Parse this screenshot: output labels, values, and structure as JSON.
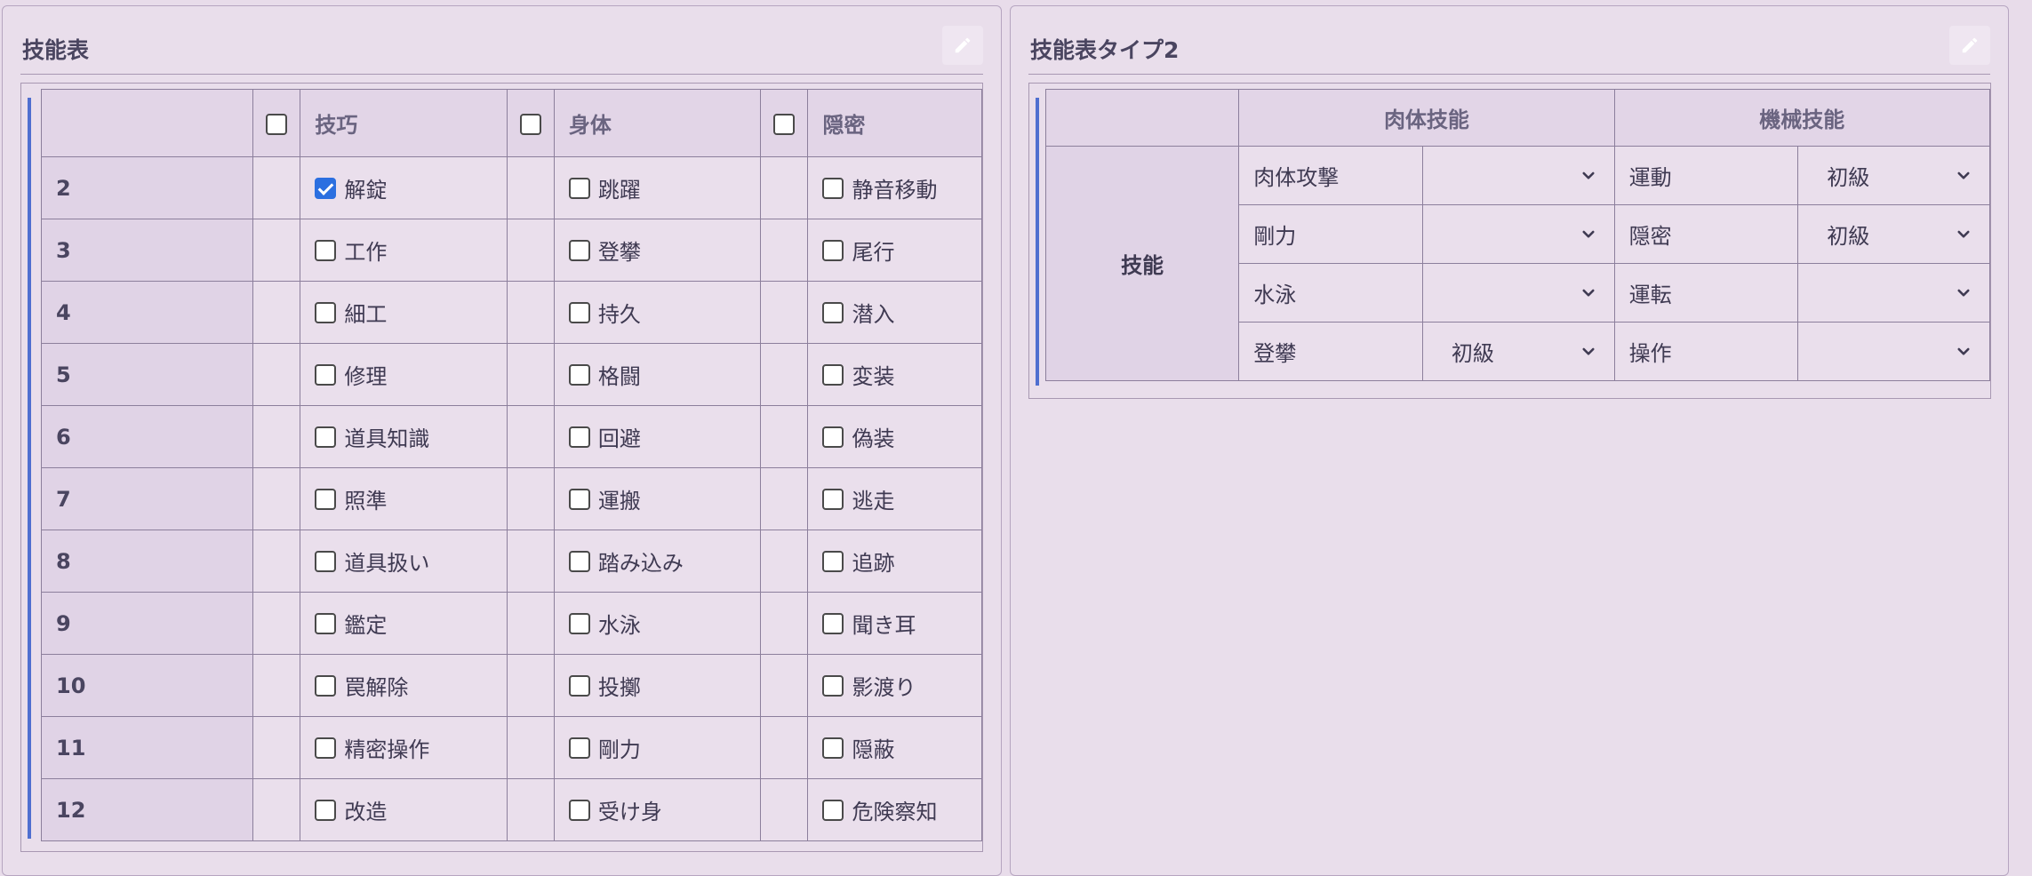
{
  "left_panel": {
    "title": "技能表",
    "headers": [
      "技巧",
      "身体",
      "隠密"
    ],
    "rows": [
      {
        "num": "2",
        "skills": [
          {
            "label": "解錠",
            "checked": true
          },
          {
            "label": "跳躍",
            "checked": false
          },
          {
            "label": "静音移動",
            "checked": false
          }
        ]
      },
      {
        "num": "3",
        "skills": [
          {
            "label": "工作",
            "checked": false
          },
          {
            "label": "登攀",
            "checked": false
          },
          {
            "label": "尾行",
            "checked": false
          }
        ]
      },
      {
        "num": "4",
        "skills": [
          {
            "label": "細工",
            "checked": false
          },
          {
            "label": "持久",
            "checked": false
          },
          {
            "label": "潜入",
            "checked": false
          }
        ]
      },
      {
        "num": "5",
        "skills": [
          {
            "label": "修理",
            "checked": false
          },
          {
            "label": "格闘",
            "checked": false
          },
          {
            "label": "変装",
            "checked": false
          }
        ]
      },
      {
        "num": "6",
        "skills": [
          {
            "label": "道具知識",
            "checked": false
          },
          {
            "label": "回避",
            "checked": false
          },
          {
            "label": "偽装",
            "checked": false
          }
        ]
      },
      {
        "num": "7",
        "skills": [
          {
            "label": "照準",
            "checked": false
          },
          {
            "label": "運搬",
            "checked": false
          },
          {
            "label": "逃走",
            "checked": false
          }
        ]
      },
      {
        "num": "8",
        "skills": [
          {
            "label": "道具扱い",
            "checked": false
          },
          {
            "label": "踏み込み",
            "checked": false
          },
          {
            "label": "追跡",
            "checked": false
          }
        ]
      },
      {
        "num": "9",
        "skills": [
          {
            "label": "鑑定",
            "checked": false
          },
          {
            "label": "水泳",
            "checked": false
          },
          {
            "label": "聞き耳",
            "checked": false
          }
        ]
      },
      {
        "num": "10",
        "skills": [
          {
            "label": "罠解除",
            "checked": false
          },
          {
            "label": "投擲",
            "checked": false
          },
          {
            "label": "影渡り",
            "checked": false
          }
        ]
      },
      {
        "num": "11",
        "skills": [
          {
            "label": "精密操作",
            "checked": false
          },
          {
            "label": "剛力",
            "checked": false
          },
          {
            "label": "隠蔽",
            "checked": false
          }
        ]
      },
      {
        "num": "12",
        "skills": [
          {
            "label": "改造",
            "checked": false
          },
          {
            "label": "受け身",
            "checked": false
          },
          {
            "label": "危険察知",
            "checked": false
          }
        ]
      }
    ]
  },
  "right_panel": {
    "title": "技能表タイプ2",
    "group_headers": [
      "肉体技能",
      "機械技能"
    ],
    "side_label": "技能",
    "rows": [
      {
        "skill1": "肉体攻撃",
        "level1": "",
        "skill2": "運動",
        "level2": "初級"
      },
      {
        "skill1": "剛力",
        "level1": "",
        "skill2": "隠密",
        "level2": "初級"
      },
      {
        "skill1": "水泳",
        "level1": "",
        "skill2": "運転",
        "level2": ""
      },
      {
        "skill1": "登攀",
        "level1": "初級",
        "skill2": "操作",
        "level2": ""
      }
    ]
  },
  "icons": {
    "edit": "pencil-icon",
    "dropdown": "chevron-down-icon"
  },
  "colors": {
    "accent": "#4f6fd0",
    "checkbox_checked": "#2b6fe0",
    "background": "#e8dcea"
  }
}
